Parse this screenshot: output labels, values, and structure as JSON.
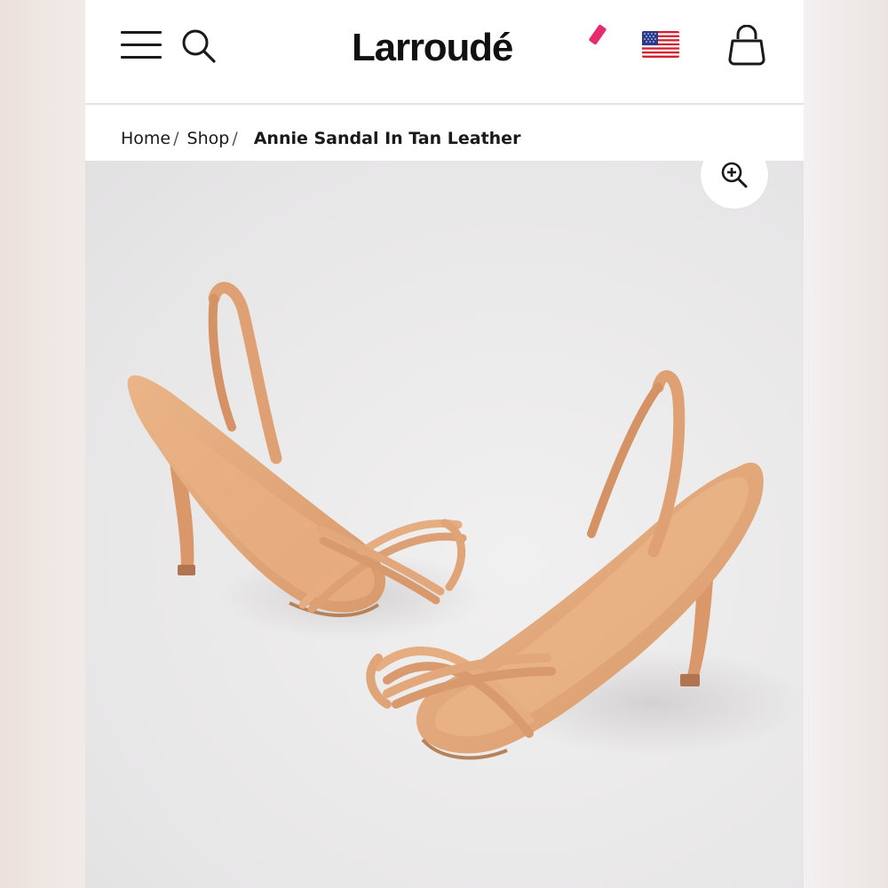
{
  "header": {
    "brand": "Larroudé",
    "menu_icon": "hamburger-menu-icon",
    "search_icon": "search-icon",
    "region_icon": "us-flag-icon",
    "cart_icon": "shopping-bag-icon"
  },
  "breadcrumb": {
    "items": [
      {
        "label": "Home"
      },
      {
        "label": "Shop"
      }
    ],
    "separator": "/",
    "current": "Annie Sandal In Tan Leather"
  },
  "product": {
    "zoom_icon": "zoom-in-icon"
  },
  "colors": {
    "brand_accent": "#e62b6f",
    "text": "#1a1a1a",
    "sandal_leather": "#e2a77a"
  }
}
